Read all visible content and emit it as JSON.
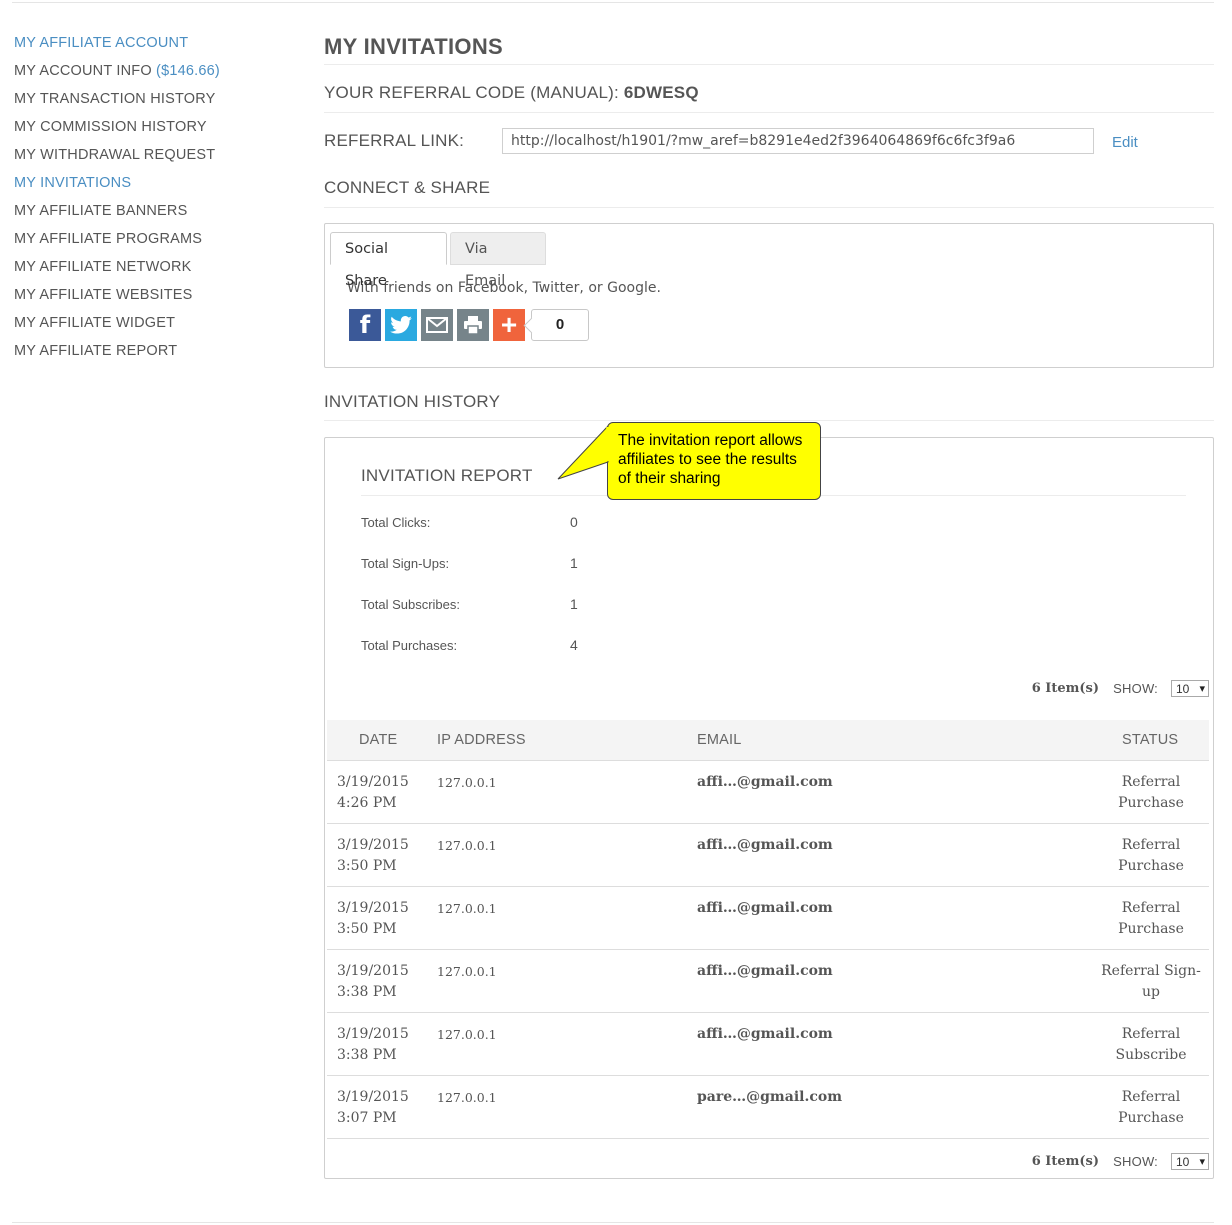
{
  "sidebar": {
    "items": [
      {
        "label": "MY AFFILIATE ACCOUNT",
        "accent": true
      },
      {
        "label": "MY ACCOUNT INFO",
        "extra": "($146.66)"
      },
      {
        "label": "MY TRANSACTION HISTORY"
      },
      {
        "label": "MY COMMISSION HISTORY"
      },
      {
        "label": "MY WITHDRAWAL REQUEST"
      },
      {
        "label": "MY INVITATIONS",
        "active": true
      },
      {
        "label": "MY AFFILIATE BANNERS"
      },
      {
        "label": "MY AFFILIATE PROGRAMS"
      },
      {
        "label": "MY AFFILIATE NETWORK"
      },
      {
        "label": "MY AFFILIATE WEBSITES"
      },
      {
        "label": "MY AFFILIATE WIDGET"
      },
      {
        "label": "MY AFFILIATE REPORT"
      }
    ]
  },
  "main": {
    "title": "MY INVITATIONS",
    "referral_code_label": "YOUR REFERRAL CODE (MANUAL):",
    "referral_code": "6DWESQ",
    "referral_link_label": "REFERRAL LINK:",
    "referral_link": "http://localhost/h1901/?mw_aref=b8291e4ed2f3964064869f6c6fc3f9a6",
    "edit_label": "Edit",
    "connect_title": "CONNECT & SHARE",
    "share": {
      "tabs": [
        "Social Share",
        "Via Email"
      ],
      "description": "With friends on Facebook, Twitter, or Google.",
      "share_count": "0",
      "icons": [
        "facebook-icon",
        "twitter-icon",
        "email-icon",
        "print-icon",
        "plus-icon"
      ]
    },
    "history_title": "INVITATION HISTORY",
    "report": {
      "title": "INVITATION REPORT",
      "stats": [
        {
          "label": "Total Clicks:",
          "value": "0"
        },
        {
          "label": "Total Sign-Ups:",
          "value": "1"
        },
        {
          "label": "Total Subscribes:",
          "value": "1"
        },
        {
          "label": "Total Purchases:",
          "value": "4"
        }
      ],
      "items_count": "6 Item(s)",
      "show_label": "SHOW:",
      "show_value": "10",
      "columns": [
        "DATE",
        "IP ADDRESS",
        "EMAIL",
        "STATUS"
      ],
      "rows": [
        {
          "date": "3/19/2015",
          "time": "4:26 PM",
          "ip": "127.0.0.1",
          "email": "affi…@gmail.com",
          "status": "Referral Purchase"
        },
        {
          "date": "3/19/2015",
          "time": "3:50 PM",
          "ip": "127.0.0.1",
          "email": "affi…@gmail.com",
          "status": "Referral Purchase"
        },
        {
          "date": "3/19/2015",
          "time": "3:50 PM",
          "ip": "127.0.0.1",
          "email": "affi…@gmail.com",
          "status": "Referral Purchase"
        },
        {
          "date": "3/19/2015",
          "time": "3:38 PM",
          "ip": "127.0.0.1",
          "email": "affi…@gmail.com",
          "status": "Referral Sign-up"
        },
        {
          "date": "3/19/2015",
          "time": "3:38 PM",
          "ip": "127.0.0.1",
          "email": "affi…@gmail.com",
          "status": "Referral Subscribe"
        },
        {
          "date": "3/19/2015",
          "time": "3:07 PM",
          "ip": "127.0.0.1",
          "email": "pare…@gmail.com",
          "status": "Referral Purchase"
        }
      ]
    }
  },
  "callout": {
    "text": "The invitation report allows affiliates to see the results of their sharing"
  },
  "colors": {
    "accent": "#4a8ec2",
    "facebook": "#3b5998",
    "twitter": "#2aa9e0",
    "share_gray": "#76848a",
    "plus": "#f0643c",
    "callout": "#ffff00"
  }
}
